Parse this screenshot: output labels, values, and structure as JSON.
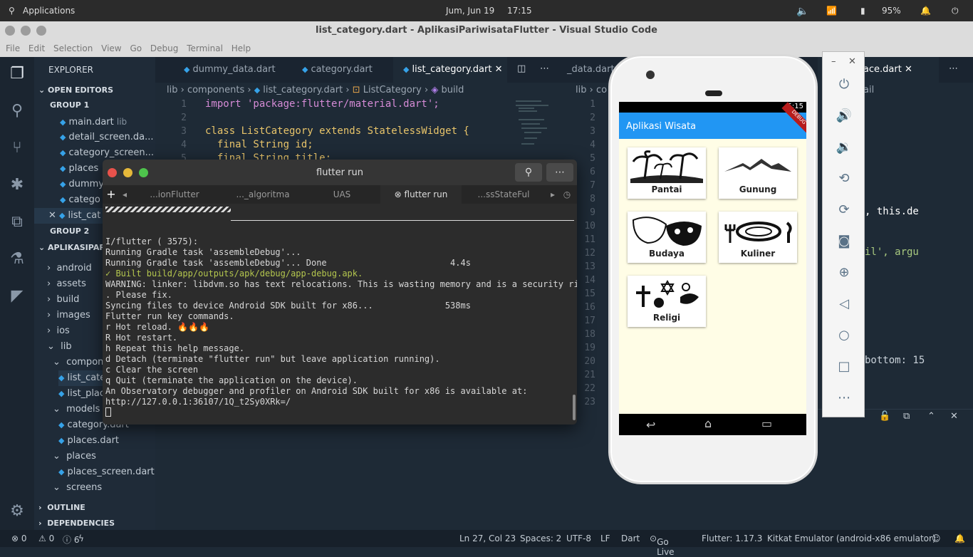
{
  "system": {
    "apps_label": "Applications",
    "date": "Jum, Jun 19",
    "time": "17:15",
    "battery": "95%"
  },
  "window": {
    "title": "list_category.dart - AplikasiPariwisataFlutter - Visual Studio Code"
  },
  "menu": [
    "File",
    "Edit",
    "Selection",
    "View",
    "Go",
    "Debug",
    "Terminal",
    "Help"
  ],
  "explorer": {
    "title": "EXPLORER",
    "open_editors": "OPEN EDITORS",
    "group1": "GROUP 1",
    "group2": "GROUP 2",
    "files_g1": [
      "main.dart",
      "detail_screen.da...",
      "category_screen...",
      "places",
      "dummy",
      "catego",
      "list_cat"
    ],
    "main_suffix": "lib",
    "project": "APLIKASIPARI",
    "tree": [
      "android",
      "assets",
      "build",
      "images",
      "ios",
      "lib",
      "compone",
      "list_cate",
      "list_plac",
      "models",
      "category.dart",
      "places.dart",
      "places",
      "places_screen.dart",
      "screens"
    ],
    "outline": "OUTLINE",
    "dependencies": "DEPENDENCIES"
  },
  "editor1": {
    "tabs": [
      "dummy_data.dart",
      "category.dart",
      "list_category.dart"
    ],
    "breadcrumb": [
      "lib",
      "components",
      "list_category.dart",
      "ListCategory",
      "build"
    ],
    "lines": [
      "1",
      "2",
      "3",
      "4",
      "5"
    ],
    "code": [
      "import 'package:flutter/material.dart';",
      "",
      "class ListCategory extends StatelessWidget {",
      "  final String id;",
      "  final String title;"
    ]
  },
  "editor2": {
    "tabs": [
      "_data.dart",
      "list_place.dart"
    ],
    "breadcrumb": [
      "lib",
      "co",
      "ail"
    ],
    "lines": [
      "1",
      "2",
      "3",
      "4",
      "5",
      "6",
      "7",
      "8",
      "9",
      "10",
      "11",
      "12",
      "13",
      "14",
      "15",
      "16",
      "17",
      "18",
      "19",
      "20",
      "21",
      "22",
      "23"
    ],
    "frag1": ", this.de",
    "frag2": "il', argu",
    "frag3": "bottom: 15"
  },
  "terminal": {
    "title": "flutter run",
    "tabs": [
      "...ionFlutter",
      "..._algoritma",
      "UAS",
      "flutter run",
      "...ssStateFul"
    ],
    "lines": [
      "I/flutter ( 3575): ",
      "Running Gradle task 'assembleDebug'...",
      "Running Gradle task 'assembleDebug'... Done                        4.4s",
      "✓ Built build/app/outputs/apk/debug/app-debug.apk.",
      "WARNING: linker: libdvm.so has text relocations. This is wasting memory and is a security risk",
      ". Please fix.",
      "Syncing files to device Android SDK built for x86...              538ms",
      "",
      "Flutter run key commands.",
      "r Hot reload. 🔥🔥🔥",
      "R Hot restart.",
      "h Repeat this help message.",
      "d Detach (terminate \"flutter run\" but leave application running).",
      "c Clear the screen",
      "q Quit (terminate the application on the device).",
      "An Observatory debugger and profiler on Android SDK built for x86 is available at:",
      "http://127.0.0.1:36107/1Q_t2Sy0XRk=/"
    ]
  },
  "phone": {
    "time": "5:15",
    "app_title": "Aplikasi Wisata",
    "debug_banner": "DEBUG",
    "categories": [
      "Pantai",
      "Gunung",
      "Budaya",
      "Kuliner",
      "Religi"
    ]
  },
  "statusbar": {
    "errors": "⊗ 0",
    "warnings": "⚠ 0",
    "info": "ⓘ 6",
    "position": "Ln 27, Col 23",
    "spaces": "Spaces: 2",
    "encoding": "UTF-8",
    "eol": "LF",
    "lang": "Dart",
    "golive": "Go Live",
    "flutter": "Flutter: 1.17.3",
    "device": "Kitkat Emulator (android-x86 emulator)"
  }
}
